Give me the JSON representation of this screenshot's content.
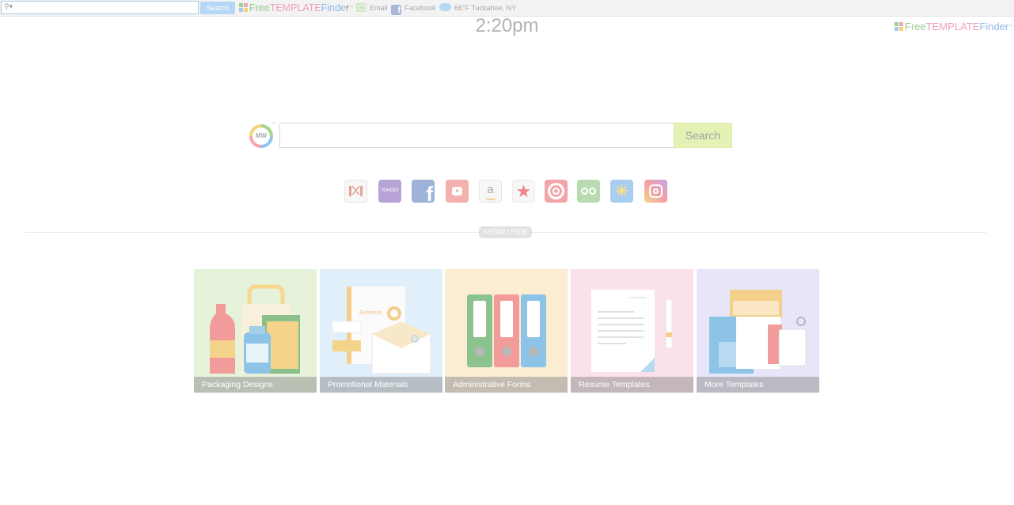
{
  "toolbar": {
    "search_value": "",
    "search_button": "Search",
    "logo": {
      "free": "Free",
      "template": "TEMPLATE",
      "finder": "Finder",
      "tm": "™"
    },
    "email_label": "Email",
    "facebook_label": "Facebook",
    "weather_label": "66°F Tuckahoe, NY"
  },
  "header": {
    "clock": "2:20pm",
    "logo": {
      "free": "Free",
      "template": "TEMPLATE",
      "finder": "Finder",
      "tm": "™"
    }
  },
  "search": {
    "logo_text": "MW",
    "logo_tm": "™",
    "input_value": "",
    "button_label": "Search"
  },
  "quick_links": [
    {
      "name": "gmail",
      "icon": "gmail-icon"
    },
    {
      "name": "yahoo",
      "icon": "yahoo-icon",
      "text": "YAHOO!"
    },
    {
      "name": "facebook",
      "icon": "facebook-icon",
      "text": "f"
    },
    {
      "name": "youtube",
      "icon": "youtube-icon"
    },
    {
      "name": "amazon",
      "icon": "amazon-icon",
      "text": "a"
    },
    {
      "name": "macys",
      "icon": "star-icon",
      "text": "★"
    },
    {
      "name": "target",
      "icon": "target-icon"
    },
    {
      "name": "tripadvisor",
      "icon": "tripadvisor-icon"
    },
    {
      "name": "walmart",
      "icon": "walmart-spark-icon",
      "text": "✳"
    },
    {
      "name": "instagram",
      "icon": "instagram-icon"
    }
  ],
  "toggle": {
    "label": "SHOW / HIDE"
  },
  "tiles": [
    {
      "label": "Packaging Designs",
      "color": "#e6f2d9"
    },
    {
      "label": "Promotional Materials",
      "color": "#e1effa",
      "art_text": "Business"
    },
    {
      "label": "Administrative Forms",
      "color": "#fbecd2"
    },
    {
      "label": "Resume Templates",
      "color": "#fbe1ec"
    },
    {
      "label": "More Templates",
      "color": "#e7e6f8"
    }
  ]
}
